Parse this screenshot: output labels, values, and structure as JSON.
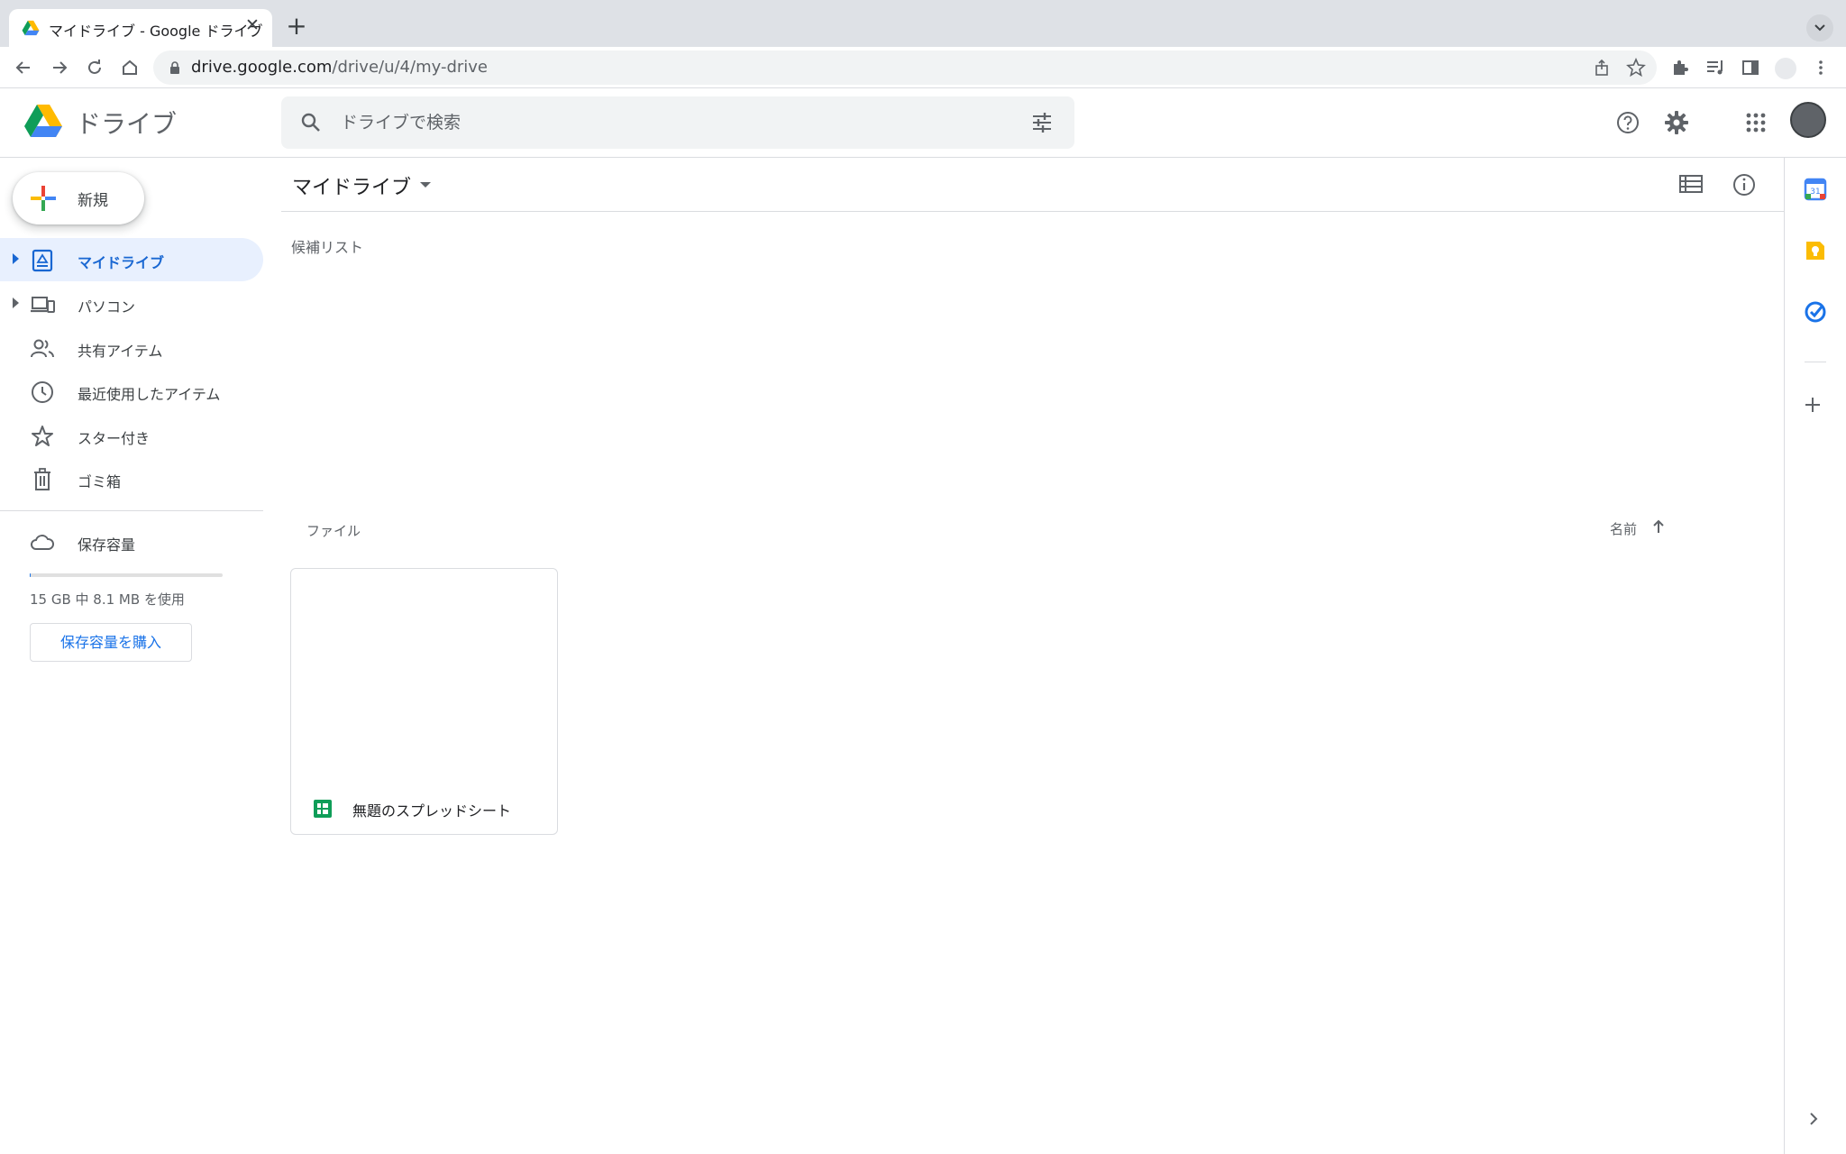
{
  "browser": {
    "tab_title": "マイドライブ - Google ドライブ",
    "tab_close": "✕",
    "new_tab": "+",
    "url_host": "drive.google.com",
    "url_path": "/drive/u/4/my-drive"
  },
  "header": {
    "app_name": "ドライブ",
    "search_placeholder": "ドライブで検索"
  },
  "sidebar": {
    "new_label": "新規",
    "items": [
      {
        "label": "マイドライブ",
        "icon": "my-drive-icon",
        "active": true,
        "expandable": true
      },
      {
        "label": "パソコン",
        "icon": "computers-icon",
        "active": false,
        "expandable": true
      },
      {
        "label": "共有アイテム",
        "icon": "shared-icon",
        "active": false,
        "expandable": false
      },
      {
        "label": "最近使用したアイテム",
        "icon": "recent-icon",
        "active": false,
        "expandable": false
      },
      {
        "label": "スター付き",
        "icon": "star-icon",
        "active": false,
        "expandable": false
      },
      {
        "label": "ゴミ箱",
        "icon": "trash-icon",
        "active": false,
        "expandable": false
      }
    ],
    "storage": {
      "label": "保存容量",
      "usage_text": "15 GB 中 8.1 MB を使用",
      "used_fraction": 0.0005,
      "buy_label": "保存容量を購入"
    }
  },
  "main": {
    "title": "マイドライブ",
    "suggested_label": "候補リスト",
    "files_label": "ファイル",
    "sort_label": "名前",
    "files": [
      {
        "name": "無題のスプレッドシート",
        "type": "spreadsheet"
      }
    ]
  },
  "colors": {
    "accent": "#1a73e8",
    "active_bg": "#e8f0fe",
    "sheets_green": "#0f9d58"
  }
}
